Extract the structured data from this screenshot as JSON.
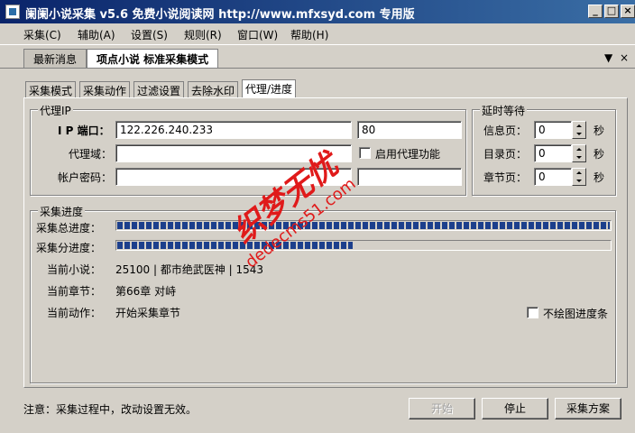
{
  "window": {
    "title": "阑阑小说采集 v5.6 免费小说阅读网 http://www.mfxsyd.com 专用版",
    "min_glyph": "_",
    "max_glyph": "□",
    "close_glyph": "×"
  },
  "menu": [
    "采集(C)",
    "辅助(A)",
    "设置(S)",
    "规则(R)",
    "窗口(W)",
    "帮助(H)"
  ],
  "doc_tabs": [
    "最新消息",
    "项点小说 标准采集模式"
  ],
  "doc_controls": {
    "dropdown": "▼",
    "close": "×"
  },
  "inner_tabs": [
    "采集模式",
    "采集动作",
    "过滤设置",
    "去除水印",
    "代理/进度"
  ],
  "active_inner_tab": "代理/进度",
  "proxy": {
    "group_title": "代理IP",
    "ip_label": "I P 端口：",
    "ip_value": "122.226.240.233",
    "port_value": "80",
    "domain_label": "代理域：",
    "domain_value": "",
    "enable_label": "启用代理功能",
    "account_label": "帐户密码：",
    "account_value": "",
    "password_value": ""
  },
  "delay": {
    "group_title": "延时等待",
    "rows": [
      {
        "label": "信息页：",
        "value": "0",
        "unit": "秒"
      },
      {
        "label": "目录页：",
        "value": "0",
        "unit": "秒"
      },
      {
        "label": "章节页：",
        "value": "0",
        "unit": "秒"
      }
    ]
  },
  "progress": {
    "group_title": "采集进度",
    "total_label": "采集总进度：",
    "total_fraction": 1.0,
    "sub_label": "采集分进度：",
    "sub_fraction": 0.48,
    "novel_label": "当前小说：",
    "novel_value": "25100 | 都市绝武医神 | 1543",
    "chapter_label": "当前章节：",
    "chapter_value": "第66章 对峙",
    "action_label": "当前动作：",
    "action_value": "开始采集章节",
    "no_draw_label": "不绘图进度条"
  },
  "status_text": "注意：采集过程中，改动设置无效。",
  "buttons": {
    "start": "开始",
    "stop": "停止",
    "scheme": "采集方案"
  },
  "watermark": {
    "big": "织梦无忧",
    "small": "dedecms51.com"
  }
}
